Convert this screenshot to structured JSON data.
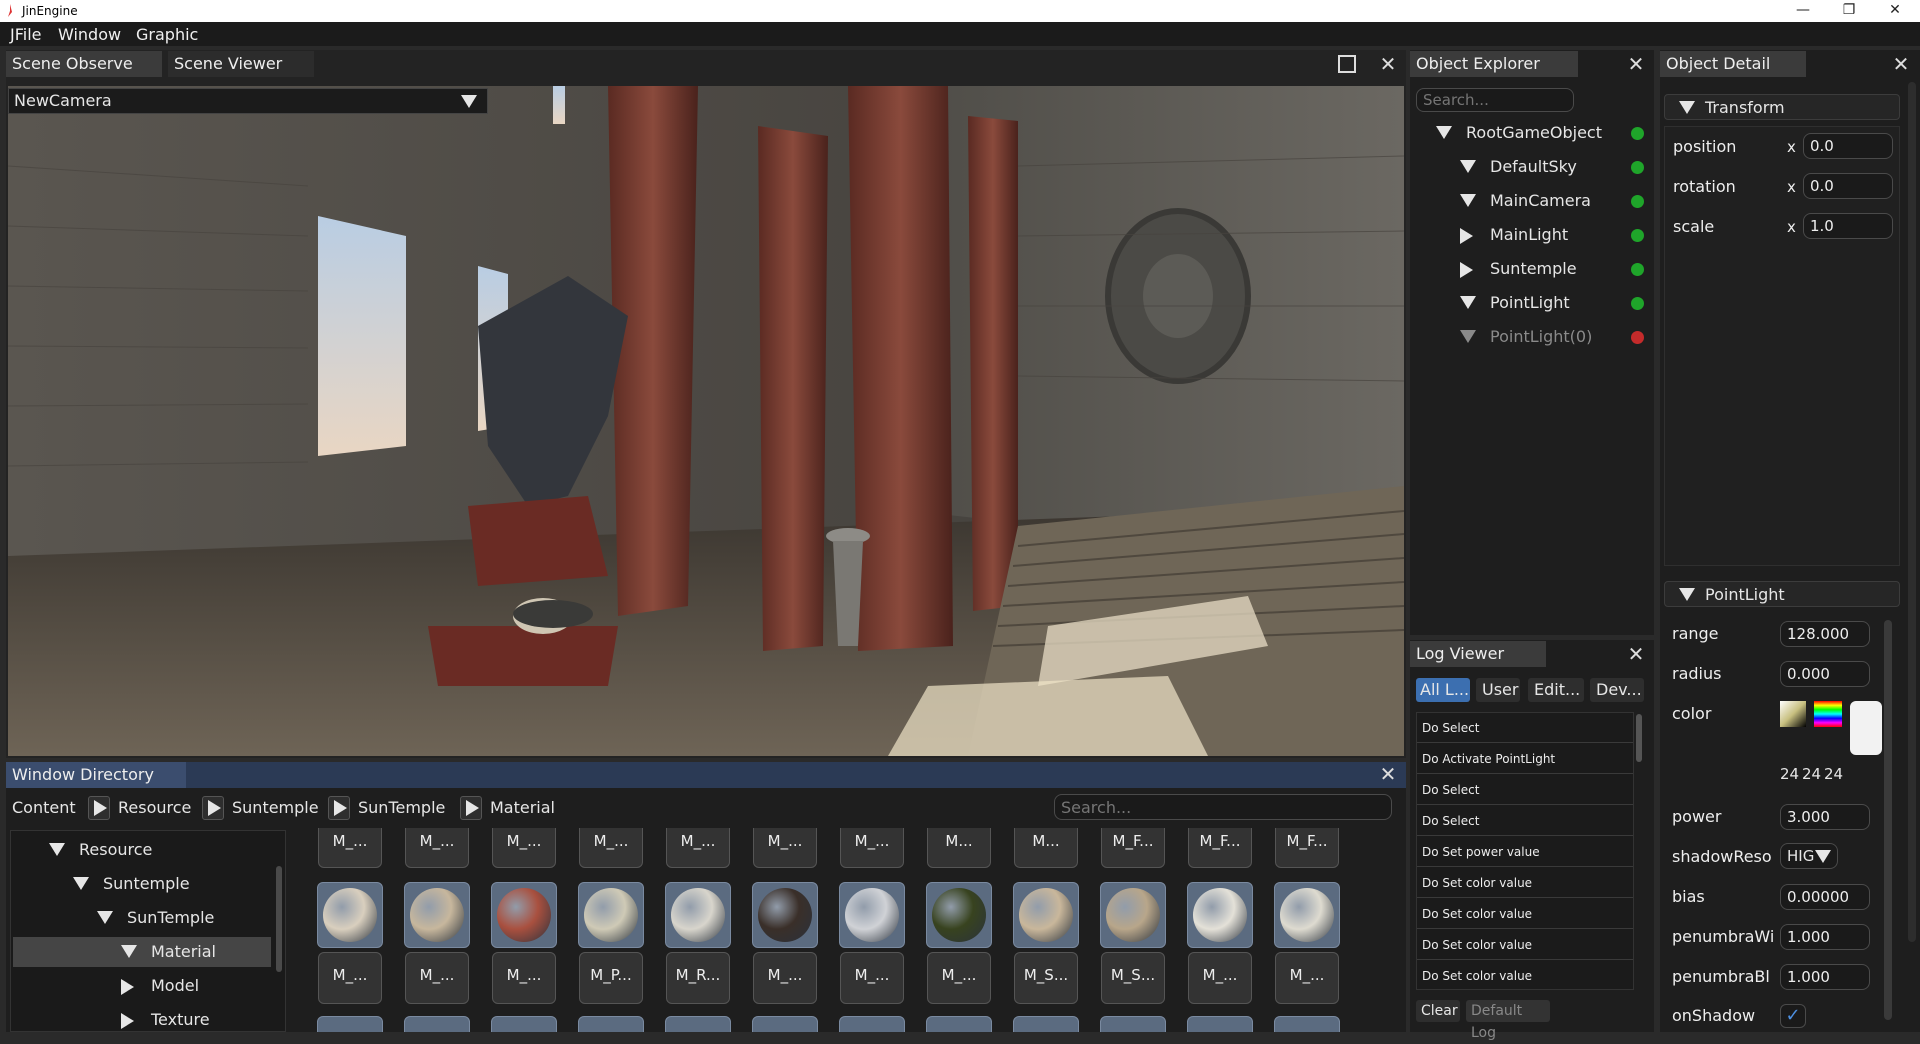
{
  "app": {
    "title": "JinEngine"
  },
  "menu": [
    "JFile",
    "Window",
    "Graphic"
  ],
  "scene": {
    "tabs": [
      "Scene Observe",
      "Scene Viewer"
    ],
    "camera_select": "NewCamera"
  },
  "object_explorer": {
    "title": "Object Explorer",
    "search_placeholder": "Search...",
    "items": [
      {
        "label": "RootGameObject",
        "expanded": true,
        "status": "#1fa52a"
      },
      {
        "label": "DefaultSky",
        "expanded": true,
        "status": "#1fa52a"
      },
      {
        "label": "MainCamera",
        "expanded": true,
        "status": "#1fa52a"
      },
      {
        "label": "MainLight",
        "expanded": false,
        "status": "#1fa52a"
      },
      {
        "label": "Suntemple",
        "expanded": false,
        "status": "#1fa52a"
      },
      {
        "label": "PointLight",
        "expanded": true,
        "status": "#1fa52a"
      },
      {
        "label": "PointLight(0)",
        "expanded": true,
        "status": "#c42b2b"
      }
    ]
  },
  "object_detail": {
    "title": "Object Detail",
    "transform": {
      "header": "Transform",
      "rows": [
        {
          "label": "position",
          "axis": "x",
          "value": "0.0"
        },
        {
          "label": "rotation",
          "axis": "x",
          "value": "0.0"
        },
        {
          "label": "scale",
          "axis": "x",
          "value": "1.0"
        }
      ]
    },
    "pointlight": {
      "header": "PointLight",
      "range": {
        "label": "range",
        "value": "128.000"
      },
      "radius": {
        "label": "radius",
        "value": "0.000"
      },
      "color": {
        "label": "color",
        "rgb": [
          "24",
          "24",
          "24"
        ]
      },
      "power": {
        "label": "power",
        "value": "3.000"
      },
      "shadowReso": {
        "label": "shadowReso",
        "value": "HIG"
      },
      "bias": {
        "label": "bias",
        "value": "0.00000"
      },
      "penumbraWi": {
        "label": "penumbraWi",
        "value": "1.000"
      },
      "penumbraBl": {
        "label": "penumbraBl",
        "value": "1.000"
      },
      "onShadow": {
        "label": "onShadow",
        "checked": true
      }
    }
  },
  "log_viewer": {
    "title": "Log Viewer",
    "tabs": [
      "All L...",
      "User",
      "Edit...",
      "Dev..."
    ],
    "entries": [
      "Do Select",
      "Do Activate PointLight",
      "Do Select",
      "Do Select",
      "Do Set power value",
      "Do Set color value",
      "Do Set color value",
      "Do Set color value",
      "Do Set color value"
    ],
    "clear_label": "Clear",
    "default_log_label": "Default Log"
  },
  "window_directory": {
    "title": "Window Directory",
    "breadcrumb": [
      "Content",
      "Resource",
      "Suntemple",
      "SunTemple",
      "Material"
    ],
    "search_placeholder": "Search...",
    "tree": [
      {
        "label": "Resource",
        "expanded": true,
        "depth": 0
      },
      {
        "label": "Suntemple",
        "expanded": true,
        "depth": 1
      },
      {
        "label": "SunTemple",
        "expanded": true,
        "depth": 2
      },
      {
        "label": "Material",
        "expanded": true,
        "depth": 3,
        "selected": true
      },
      {
        "label": "Model",
        "expanded": false,
        "depth": 3
      },
      {
        "label": "Texture",
        "expanded": false,
        "depth": 3
      }
    ],
    "top_labels": [
      "M_...",
      "M_...",
      "M_...",
      "M_...",
      "M_...",
      "M_...",
      "M_...",
      "M...",
      "M...",
      "M_F...",
      "M_F...",
      "M_F..."
    ],
    "assets": [
      {
        "label": "M_...",
        "color": "#d9cfbe"
      },
      {
        "label": "M_...",
        "color": "#c7b79d"
      },
      {
        "label": "M_...",
        "color": "#a9503f"
      },
      {
        "label": "M_P...",
        "color": "#cfcab6"
      },
      {
        "label": "M_R...",
        "color": "#d8d5cc"
      },
      {
        "label": "M_...",
        "color": "#3a2f29"
      },
      {
        "label": "M_...",
        "color": "#d0d2d6"
      },
      {
        "label": "M_...",
        "color": "#38431f"
      },
      {
        "label": "M_S...",
        "color": "#c9b79b"
      },
      {
        "label": "M_S...",
        "color": "#b8a68a"
      },
      {
        "label": "M_...",
        "color": "#e4e1d8"
      },
      {
        "label": "M_...",
        "color": "#dedbd0"
      }
    ]
  }
}
